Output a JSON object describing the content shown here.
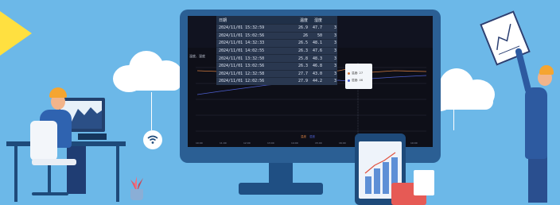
{
  "colors": {
    "background": "#6cb8e8",
    "monitor_frame": "#2b5f94",
    "accent_yellow": "#ffe040",
    "helmet": "#f5a531",
    "line_orange": "#d17b3f",
    "line_blue": "#4d5fd0"
  },
  "table": {
    "headers": [
      "日期",
      "温度",
      "湿度",
      ""
    ],
    "rows": [
      [
        "2024/11/01 15:32:59",
        "26.9",
        "47.7",
        "3"
      ],
      [
        "2024/11/01 15:02:56",
        "26",
        "50",
        "3"
      ],
      [
        "2024/11/01 14:32:33",
        "26.5",
        "48.1",
        "3"
      ],
      [
        "2024/11/01 14:02:55",
        "26.3",
        "47.6",
        "3"
      ],
      [
        "2024/11/01 13:32:50",
        "25.8",
        "48.3",
        "3"
      ],
      [
        "2024/11/01 13:02:56",
        "26.3",
        "46.8",
        "3"
      ],
      [
        "2024/11/01 12:32:58",
        "27.7",
        "43.0",
        "3"
      ],
      [
        "2024/11/01 12:02:56",
        "27.9",
        "44.2",
        "3"
      ]
    ]
  },
  "chart": {
    "title": "温度、湿度",
    "tooltip_series": [
      "温度: 27",
      "湿度: 46"
    ],
    "legend": [
      "温度",
      "湿度"
    ]
  },
  "icons": {
    "wifi_left": "wifi-icon",
    "wifi_right": "wifi-icon"
  }
}
